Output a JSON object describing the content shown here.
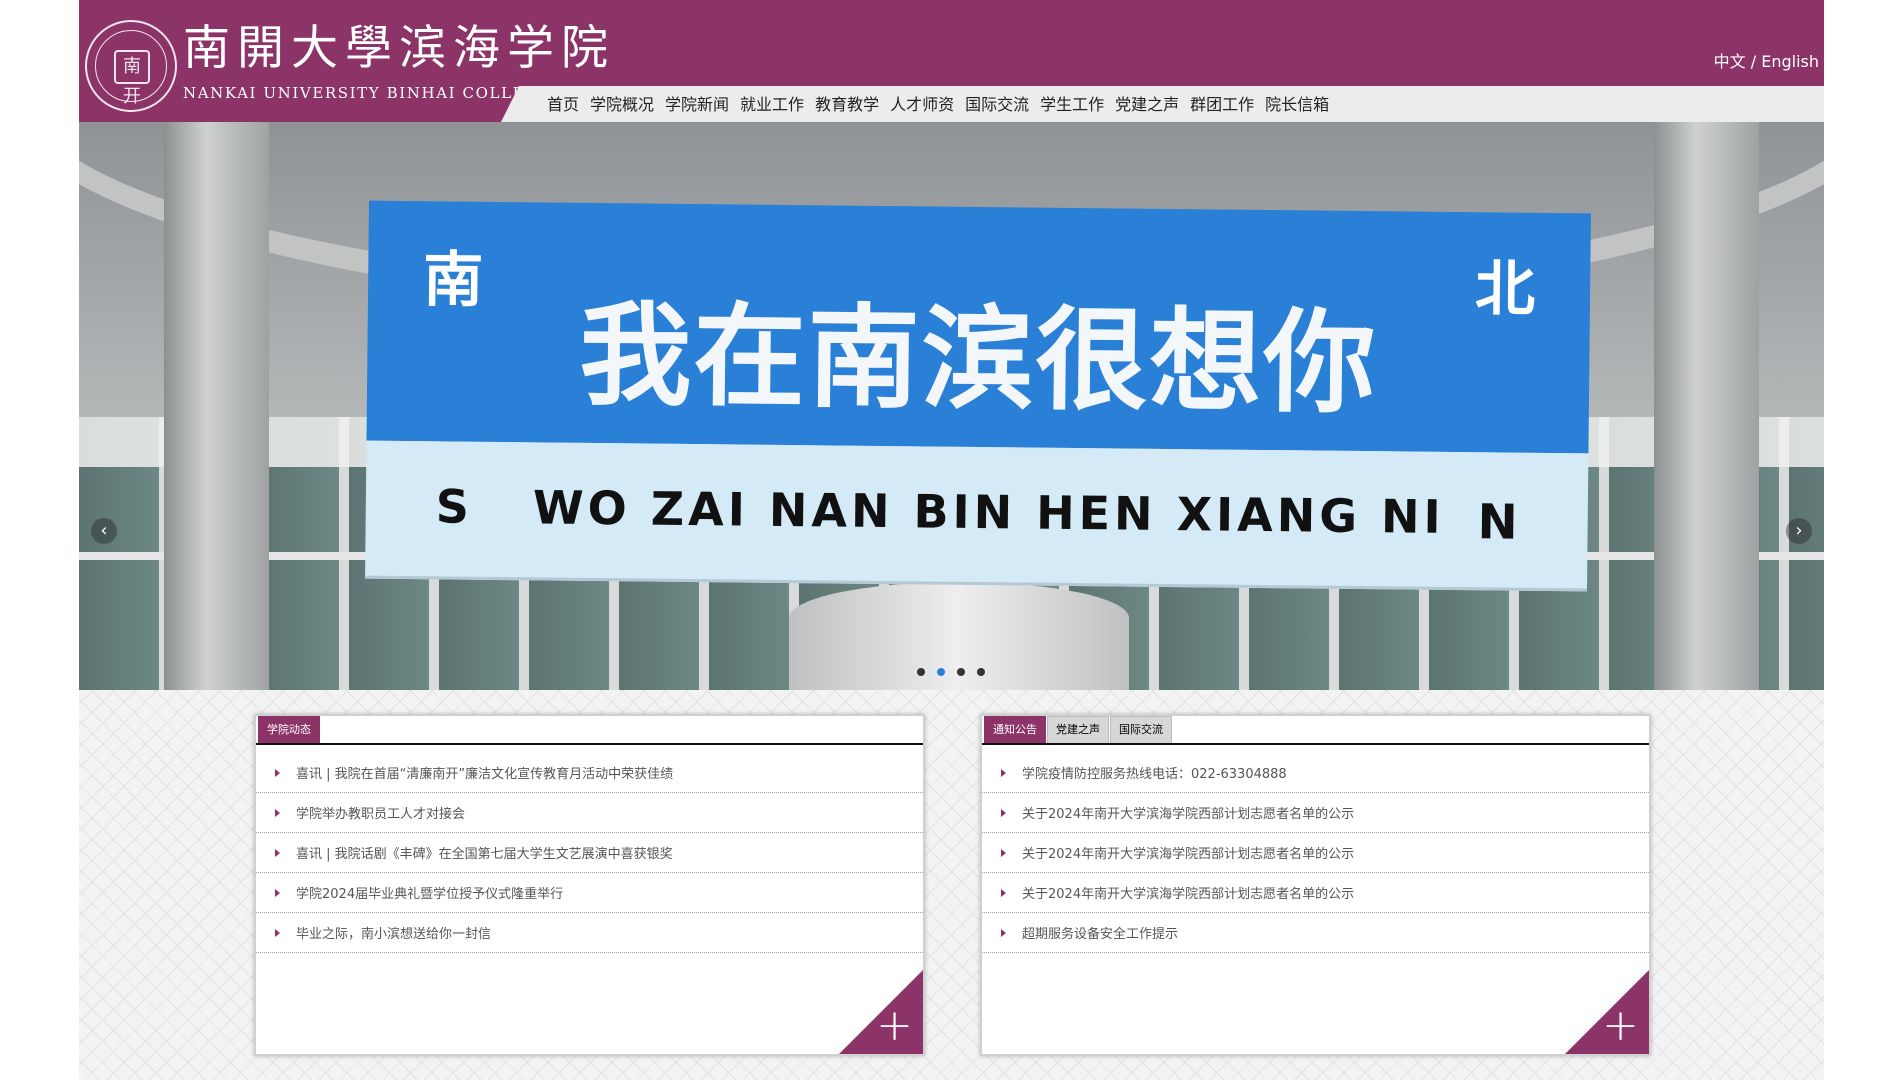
{
  "header": {
    "brand_cn": "南開大學滨海学院",
    "brand_en": "NANKAI UNIVERSITY BINHAI COLLEGE",
    "lang_switch": "中文 / English",
    "logo_glyph": "南开",
    "colors": {
      "primary": "#8c3468",
      "nav_bg": "#ececec"
    }
  },
  "nav": {
    "items": [
      {
        "label": "首页"
      },
      {
        "label": "学院概况"
      },
      {
        "label": "学院新闻"
      },
      {
        "label": "就业工作"
      },
      {
        "label": "教育教学"
      },
      {
        "label": "人才师资"
      },
      {
        "label": "国际交流"
      },
      {
        "label": "学生工作"
      },
      {
        "label": "党建之声"
      },
      {
        "label": "群团工作"
      },
      {
        "label": "院长信箱"
      }
    ]
  },
  "banner": {
    "sign_south": "南",
    "sign_north": "北",
    "sign_main": "我在南滨很想你",
    "sign_pinyin": "S   WO ZAI NAN BIN HEN XIANG NI",
    "sign_n": "N",
    "prev_icon": "‹",
    "next_icon": "›",
    "slides_count": 4,
    "active_slide": 2
  },
  "left_panel": {
    "tabs": [
      {
        "label": "学院动态",
        "active": true
      }
    ],
    "items": [
      "喜讯 | 我院在首届“清廉南开”廉洁文化宣传教育月活动中荣获佳绩",
      "学院举办教职员工人才对接会",
      "喜讯 | 我院话剧《丰碑》在全国第七届大学生文艺展演中喜获银奖",
      "学院2024届毕业典礼暨学位授予仪式隆重举行",
      "毕业之际，南小滨想送给你一封信"
    ],
    "more_icon": "+"
  },
  "right_panel": {
    "tabs": [
      {
        "label": "通知公告",
        "active": true
      },
      {
        "label": "党建之声",
        "active": false
      },
      {
        "label": "国际交流",
        "active": false
      }
    ],
    "items": [
      "学院疫情防控服务热线电话：022-63304888",
      "关于2024年南开大学滨海学院西部计划志愿者名单的公示",
      "关于2024年南开大学滨海学院西部计划志愿者名单的公示",
      "关于2024年南开大学滨海学院西部计划志愿者名单的公示",
      "超期服务设备安全工作提示"
    ],
    "more_icon": "+"
  }
}
